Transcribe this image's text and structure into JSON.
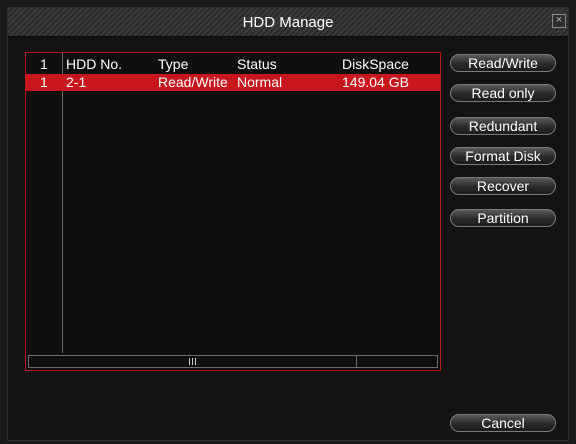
{
  "window": {
    "title": "HDD Manage",
    "close_glyph": "×"
  },
  "table": {
    "headers": {
      "index": "1",
      "hdd_no": "HDD No.",
      "type": "Type",
      "status": "Status",
      "disk_space": "DiskSpace"
    },
    "rows": [
      {
        "index": "1",
        "hdd_no": "2-1",
        "type": "Read/Write",
        "status": "Normal",
        "disk_space": "149.04 GB"
      }
    ]
  },
  "buttons": {
    "read_write": "Read/Write",
    "read_only": "Read only",
    "redundant": "Redundant",
    "format_disk": "Format Disk",
    "recover": "Recover",
    "partition": "Partition",
    "cancel": "Cancel"
  },
  "colors": {
    "selection": "#c8161d",
    "panel_border": "#b31b1b",
    "background": "#131313"
  }
}
